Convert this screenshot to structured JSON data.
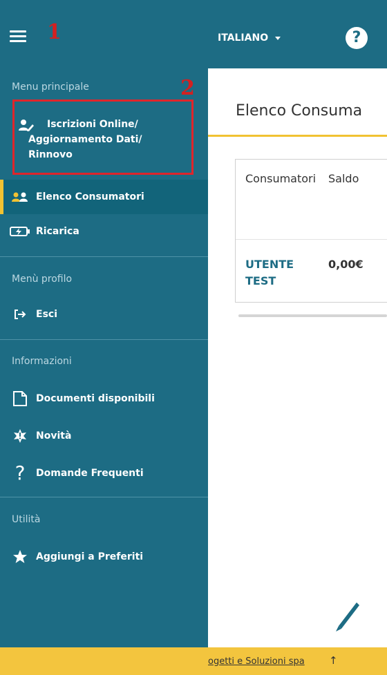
{
  "topbar": {
    "annotation": "1",
    "language_label": "ITALIANO",
    "help_label": "?"
  },
  "sidebar": {
    "annotation": "2",
    "sections": {
      "main": "Menu principale",
      "profile": "Menù profilo",
      "info": "Informazioni",
      "utility": "Utilità"
    },
    "items": {
      "iscrizioni_line1": "Iscrizioni Online/",
      "iscrizioni_line2": "Aggiornamento Dati/",
      "iscrizioni_line3": "Rinnovo",
      "elenco": "Elenco Consumatori",
      "ricarica": "Ricarica",
      "esci": "Esci",
      "documenti": "Documenti disponibili",
      "novita": "Novità",
      "faq": "Domande Frequenti",
      "preferiti": "Aggiungi a Preferiti"
    },
    "active_item": "Elenco Consumatori"
  },
  "main": {
    "title": "Elenco Consuma",
    "table": {
      "headers": [
        "Consumatori",
        "Saldo"
      ],
      "rows": [
        {
          "consumer_line1": "UTENTE",
          "consumer_line2": "TEST",
          "balance": "0,00€"
        }
      ]
    }
  },
  "footer": {
    "link_text": "ogetti e Soluzioni spa",
    "arrow": "↑"
  },
  "colors": {
    "primary": "#1d6c84",
    "accent": "#f1c232",
    "annotation_red": "#d42020"
  }
}
